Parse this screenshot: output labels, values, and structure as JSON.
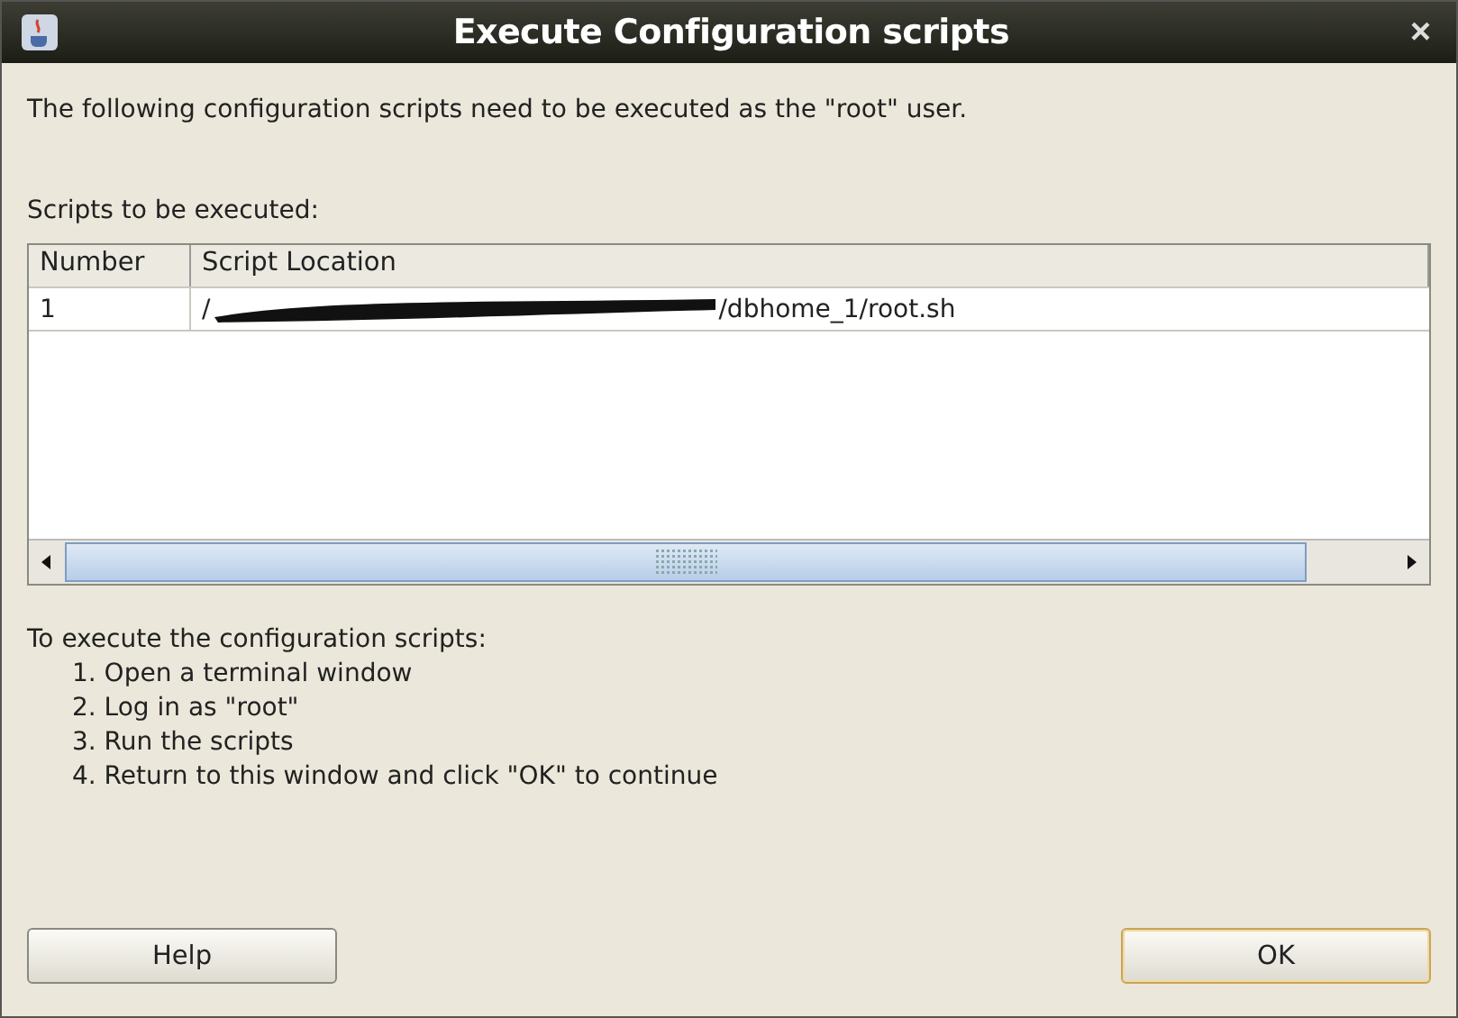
{
  "window": {
    "title": "Execute Configuration scripts",
    "close": "×"
  },
  "intro": "The following configuration scripts need to be executed as the \"root\" user.",
  "table_label": "Scripts to be executed:",
  "table": {
    "columns": [
      "Number",
      "Script Location"
    ],
    "rows": [
      {
        "number": "1",
        "location_visible_start": "/",
        "location": "/dbhome_1/root.sh",
        "redacted": true
      }
    ]
  },
  "instructions": {
    "heading": "To execute the configuration scripts:",
    "steps": [
      "1. Open a terminal window",
      "2. Log in as \"root\"",
      "3. Run the scripts",
      "4. Return to this window and click \"OK\" to continue"
    ]
  },
  "buttons": [
    {
      "label": "Help",
      "default": false
    },
    {
      "label": "OK",
      "default": true
    }
  ]
}
